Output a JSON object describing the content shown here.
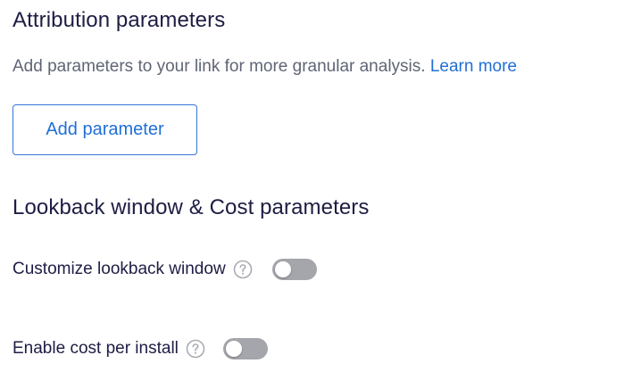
{
  "attribution": {
    "title": "Attribution parameters",
    "description": "Add parameters to your link for more granular analysis.",
    "learn_more_label": "Learn more",
    "add_button_label": "Add parameter"
  },
  "lookback": {
    "title": "Lookback window & Cost parameters",
    "settings": [
      {
        "label": "Customize lookback window",
        "help_icon": "question-circle-icon",
        "enabled": false
      },
      {
        "label": "Enable cost per install",
        "help_icon": "question-circle-icon",
        "enabled": false
      }
    ]
  },
  "colors": {
    "heading": "#1d1d44",
    "body_text": "#5f6575",
    "link": "#1f6fd6",
    "button_border": "#3576d6",
    "toggle_off": "#a4a6ab"
  }
}
